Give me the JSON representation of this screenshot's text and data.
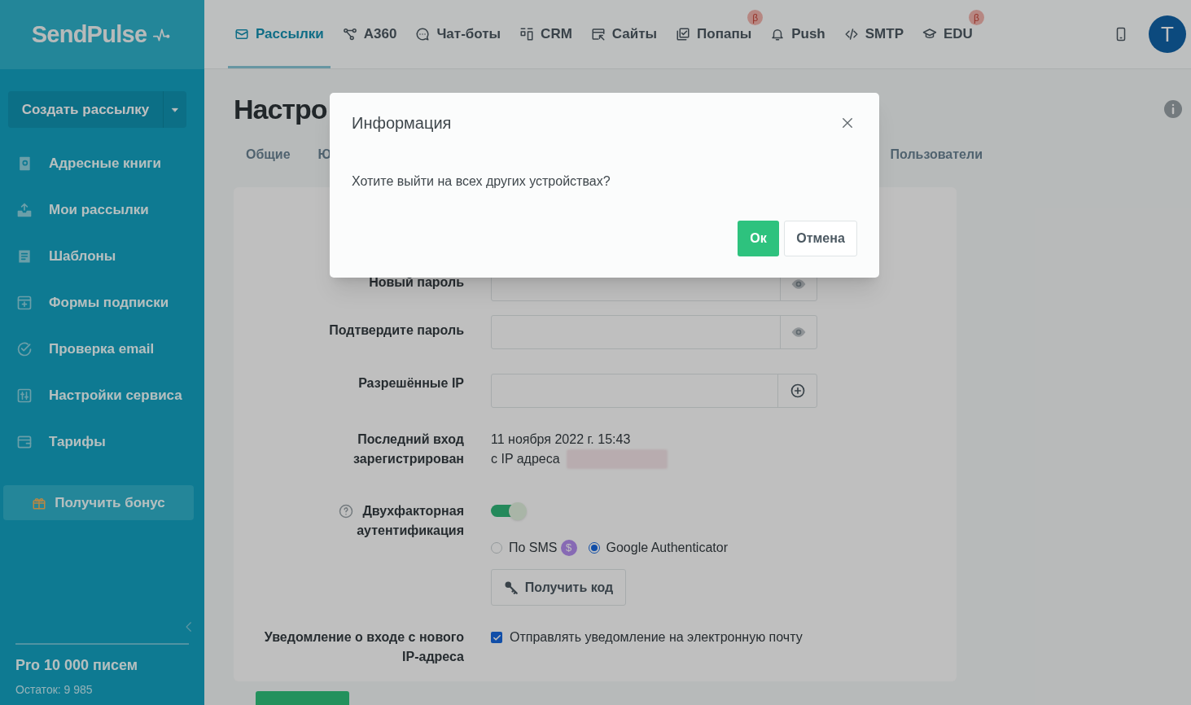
{
  "logo": "SendPulse",
  "top_nav": [
    {
      "label": "Рассылки",
      "selected": true
    },
    {
      "label": "A360",
      "selected": false
    },
    {
      "label": "Чат-боты",
      "selected": false
    },
    {
      "label": "CRM",
      "selected": false
    },
    {
      "label": "Сайты",
      "selected": false
    },
    {
      "label": "Попапы",
      "selected": false,
      "badge": "β"
    },
    {
      "label": "Push",
      "selected": false
    },
    {
      "label": "SMTP",
      "selected": false
    },
    {
      "label": "EDU",
      "selected": false,
      "badge": "β"
    }
  ],
  "avatar": "T",
  "sidebar": {
    "create_button": "Создать рассылку",
    "items": [
      {
        "label": "Адресные книги"
      },
      {
        "label": "Мои рассылки"
      },
      {
        "label": "Шаблоны"
      },
      {
        "label": "Формы подписки"
      },
      {
        "label": "Проверка email"
      },
      {
        "label": "Настройки сервиса"
      },
      {
        "label": "Тарифы"
      }
    ],
    "bonus_button": "Получить бонус",
    "plan": "Pro 10 000 писем",
    "remaining": "Остаток: 9 985"
  },
  "page": {
    "title": "Настро",
    "tabs": [
      {
        "label": "Общие"
      },
      {
        "label": "Ю"
      },
      {
        "label": "Пользователи"
      }
    ],
    "form": {
      "rows": [
        {
          "kind": "password",
          "label": "Новый пароль"
        },
        {
          "kind": "password",
          "label": "Подтвердите пароль"
        },
        {
          "kind": "ip",
          "label": "Разрешённые IP"
        },
        {
          "kind": "info",
          "label": "Последний вход\nзарегистрирован",
          "lines": [
            "11 ноября 2022 г. 15:43",
            "с IP адреса"
          ]
        },
        {
          "kind": "twofactor",
          "label": "Двухфакторная\nаутентификация",
          "on": true,
          "options": [
            {
              "label": "По SMS",
              "selected": false,
              "badge": "$"
            },
            {
              "label": "Google Authenticator",
              "selected": true
            }
          ],
          "button": "Получить код"
        },
        {
          "kind": "checkbox",
          "label": "Уведомление о входе с нового\nIP-адреса",
          "checkbox_label": "Отправлять уведомление на электронную почту",
          "checked": true
        }
      ]
    }
  },
  "modal": {
    "title": "Информация",
    "message": "Хотите выйти на всех других устройствах?",
    "buttons": [
      {
        "label": "Ок",
        "kind": "primary"
      },
      {
        "label": "Отмена",
        "kind": "secondary"
      }
    ]
  }
}
